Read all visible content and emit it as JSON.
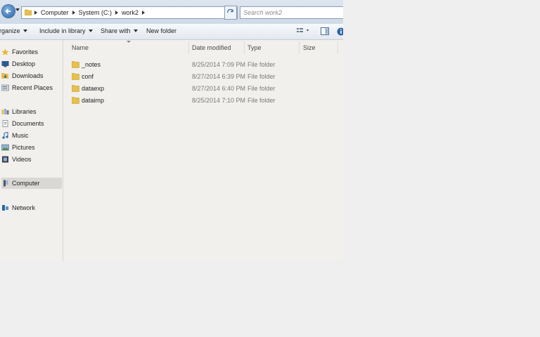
{
  "address": {
    "crumbs": [
      "Computer",
      "System (C:)",
      "work2"
    ],
    "search_placeholder": "Search work2"
  },
  "toolbar": {
    "organize": "Organize",
    "include_in_library": "Include in library",
    "share_with": "Share with",
    "new_folder": "New folder"
  },
  "sidebar": {
    "favorites": "Favorites",
    "desktop": "Desktop",
    "downloads": "Downloads",
    "recent_places": "Recent Places",
    "libraries": "Libraries",
    "documents": "Documents",
    "music": "Music",
    "pictures": "Pictures",
    "videos": "Videos",
    "computer": "Computer",
    "network": "Network"
  },
  "columns": {
    "name": "Name",
    "date_modified": "Date modified",
    "type": "Type",
    "size": "Size"
  },
  "files": [
    {
      "name": "_notes",
      "date": "8/25/2014 7:09 PM",
      "type": "File folder"
    },
    {
      "name": "conf",
      "date": "8/27/2014 6:39 PM",
      "type": "File folder"
    },
    {
      "name": "dataexp",
      "date": "8/27/2014 6:40 PM",
      "type": "File folder"
    },
    {
      "name": "dataimp",
      "date": "8/25/2014 7:10 PM",
      "type": "File folder"
    }
  ],
  "colors": {
    "folder": "#e8c04a",
    "selection": "#dad8d4",
    "window_bg": "#f2f0ed"
  }
}
